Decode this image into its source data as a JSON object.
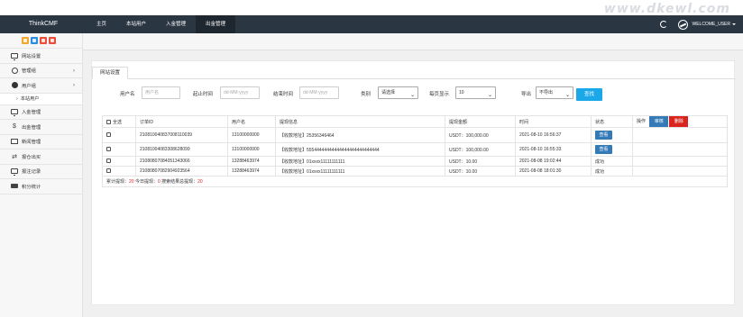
{
  "header": {
    "brand": "ThinkCMF",
    "watermark": "www.dkewl.com",
    "nav": [
      "主页",
      "本站用户",
      "入金管理",
      "出金管理"
    ],
    "active_nav": 3,
    "user": "WELCOME_USER"
  },
  "sidebar": {
    "quick_colors": [
      "#f0a830",
      "#2a8de0",
      "#e84e3c",
      "#e84e3c"
    ],
    "items": [
      {
        "label": "网站设置",
        "icon": "monitor-icon",
        "has_children": false
      },
      {
        "label": "管理组",
        "icon": "user-circle-icon",
        "has_children": true
      },
      {
        "label": "用户组",
        "icon": "user-icon",
        "has_children": true
      },
      {
        "label": "本站用户",
        "icon": "",
        "sub": true
      },
      {
        "label": "入金管理",
        "icon": "monitor-icon",
        "has_children": false
      },
      {
        "label": "出金管理",
        "icon": "dollar-icon",
        "has_children": false
      },
      {
        "label": "新闻管理",
        "icon": "news-icon",
        "has_children": false
      },
      {
        "label": "报仓出买",
        "icon": "swap-icon",
        "has_children": false
      },
      {
        "label": "报注记录",
        "icon": "monitor-icon",
        "has_children": false
      },
      {
        "label": "积分统计",
        "icon": "vip-icon",
        "has_children": false
      }
    ]
  },
  "tab": {
    "label": "网站设置"
  },
  "filters": {
    "username_label": "用户名",
    "username_placeholder": "用户名",
    "start_label": "起止时间",
    "start_placeholder": "dd-MM-yyyy",
    "end_label": "结束时间",
    "end_placeholder": "dd-MM-yyyy",
    "type_label": "类别",
    "type_value": "请选择",
    "per_page_label": "每页显示",
    "per_page_value": "10",
    "export_label": "导出",
    "export_value": "不导出",
    "search_button": "查找"
  },
  "table": {
    "headers": {
      "select_all": "全选",
      "order_id": "订单ID",
      "username": "用户名",
      "info": "提现信息",
      "amount": "提现金额",
      "time": "时间",
      "status": "状态",
      "action": "操作",
      "audit": "审核",
      "delete": "删除"
    },
    "rows": [
      {
        "order_id": "21081004083700811003​9",
        "username": "13100000000",
        "info": "【收款地址】25356346464",
        "amount": "USDT：100,000.00",
        "time": "2021-08-10 16:56:37",
        "status": "查看",
        "status_type": "button"
      },
      {
        "order_id": "21081004083308628099",
        "username": "13100000000",
        "info": "【收款地址】55544444444444444444444444444",
        "amount": "USDT：100,000.00",
        "time": "2021-08-10 16:55:33",
        "status": "查看",
        "status_type": "button"
      },
      {
        "order_id": "21080807084051343066",
        "username": "13288463974",
        "info": "【收款地址】01xxxx11111111111",
        "amount": "USDT：10.00",
        "time": "2021-08-08 19:02:44",
        "status": "成功",
        "status_type": "text"
      },
      {
        "order_id": "21080807082904923564",
        "username": "13288463974",
        "info": "【收款地址】01xxxx11111111111",
        "amount": "USDT：10.00",
        "time": "2021-08-08 18:01:30",
        "status": "成功",
        "status_type": "text"
      }
    ],
    "summary": {
      "total_label": "累计提现：",
      "total_value": "20",
      "today_label": " 今日提现：",
      "today_value": "0",
      "search_label": " 搜索结果总提现：",
      "search_value": "20"
    }
  }
}
